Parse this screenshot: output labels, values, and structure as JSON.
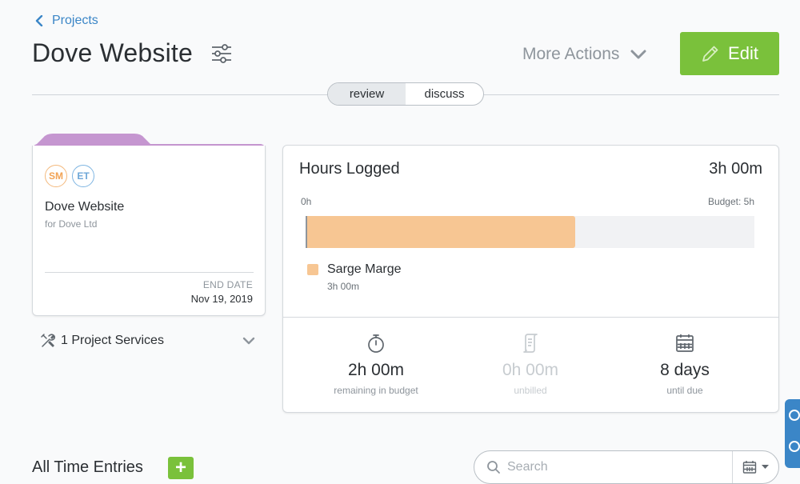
{
  "nav": {
    "back_label": "Projects"
  },
  "header": {
    "title": "Dove Website",
    "more_actions_label": "More Actions",
    "edit_label": "Edit"
  },
  "tabs": [
    {
      "label": "review",
      "active": true
    },
    {
      "label": "discuss",
      "active": false
    }
  ],
  "project_card": {
    "avatars": [
      "SM",
      "ET"
    ],
    "name": "Dove Website",
    "client": "for Dove Ltd",
    "end_date_label": "END DATE",
    "end_date": "Nov 19, 2019",
    "folder_color": "#c596d0"
  },
  "services": {
    "label": "1 Project Services"
  },
  "hours": {
    "title": "Hours Logged",
    "total": "3h 00m",
    "bar_start_label": "0h",
    "budget_label": "Budget: 5h",
    "budget_fraction_used": 0.6,
    "legend": {
      "name": "Sarge Marge",
      "value": "3h 00m",
      "color": "#f7c693"
    },
    "stats": [
      {
        "icon": "stopwatch-icon",
        "value": "2h 00m",
        "label": "remaining in budget",
        "muted": false
      },
      {
        "icon": "invoice-icon",
        "value": "0h 00m",
        "label": "unbilled",
        "muted": true
      },
      {
        "icon": "calendar-icon",
        "value": "8 days",
        "label": "until due",
        "muted": false
      }
    ]
  },
  "entries": {
    "title": "All Time Entries",
    "add_label": "+",
    "search_placeholder": "Search"
  },
  "colors": {
    "accent_green": "#7ac13b",
    "link_blue": "#3b86c7"
  }
}
